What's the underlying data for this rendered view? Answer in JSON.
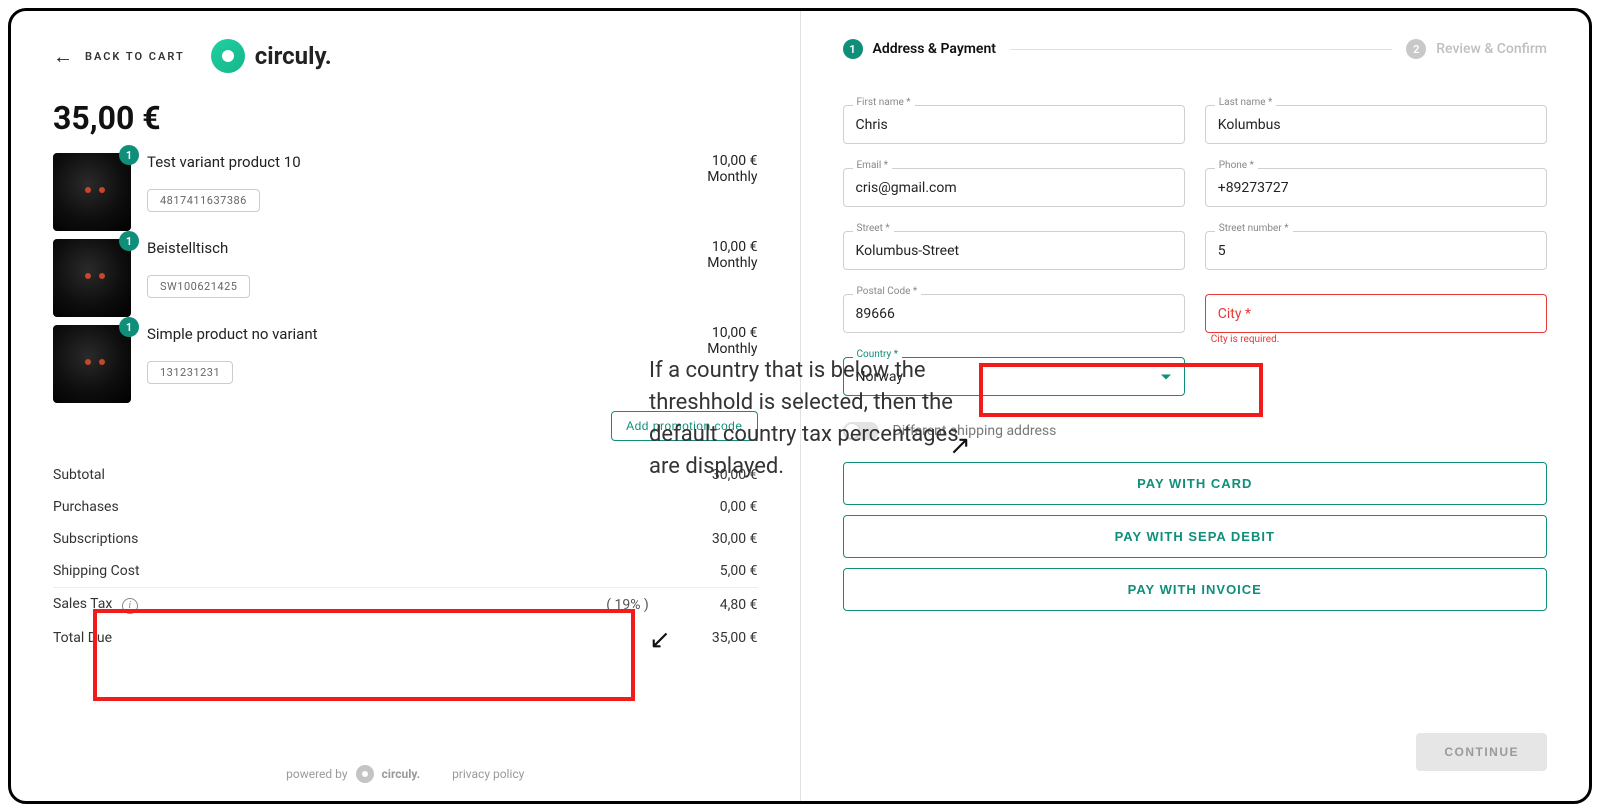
{
  "left": {
    "back_label": "BACK TO CART",
    "brand": "circuly.",
    "grand_total": "35,00 €",
    "items": [
      {
        "qty": "1",
        "name": "Test variant product 10",
        "sku": "4817411637386",
        "price": "10,00 €",
        "period": "Monthly"
      },
      {
        "qty": "1",
        "name": "Beistelltisch",
        "sku": "SW100621425",
        "price": "10,00 €",
        "period": "Monthly"
      },
      {
        "qty": "1",
        "name": "Simple product no variant",
        "sku": "131231231",
        "price": "10,00 €",
        "period": "Monthly"
      }
    ],
    "promo_label": "Add promotion code",
    "summary": {
      "subtotal_label": "Subtotal",
      "subtotal_val": "30,00 €",
      "purchases_label": "Purchases",
      "purchases_val": "0,00 €",
      "subs_label": "Subscriptions",
      "subs_val": "30,00 €",
      "ship_label": "Shipping Cost",
      "ship_val": "5,00 €",
      "tax_label": "Sales Tax",
      "tax_pct": "( 19% )",
      "tax_val": "4,80 €",
      "due_label": "Total Due",
      "due_val": "35,00 €"
    },
    "footer_powered": "powered by",
    "footer_brand": "circuly.",
    "footer_privacy": "privacy policy"
  },
  "right": {
    "step1_num": "1",
    "step1_label": "Address & Payment",
    "step2_num": "2",
    "step2_label": "Review & Confirm",
    "fields": {
      "first_label": "First name *",
      "first_val": "Chris",
      "last_label": "Last name *",
      "last_val": "Kolumbus",
      "email_label": "Email *",
      "email_val": "cris@gmail.com",
      "phone_label": "Phone *",
      "phone_val": "+89273727",
      "street_label": "Street *",
      "street_val": "Kolumbus-Street",
      "stnum_label": "Street number *",
      "stnum_val": "5",
      "postal_label": "Postal Code *",
      "postal_val": "89666",
      "city_label": "City *",
      "city_err": "City is required.",
      "country_label": "Country *",
      "country_val": "Norway"
    },
    "shipping_toggle_label": "Different shipping address",
    "pay_card": "PAY WITH CARD",
    "pay_sepa": "PAY WITH SEPA DEBIT",
    "pay_invoice": "PAY WITH INVOICE",
    "continue": "CONTINUE"
  },
  "annotation": {
    "text": "If a country that is below the threshhold is selected, then the default country tax percentages are displayed."
  }
}
